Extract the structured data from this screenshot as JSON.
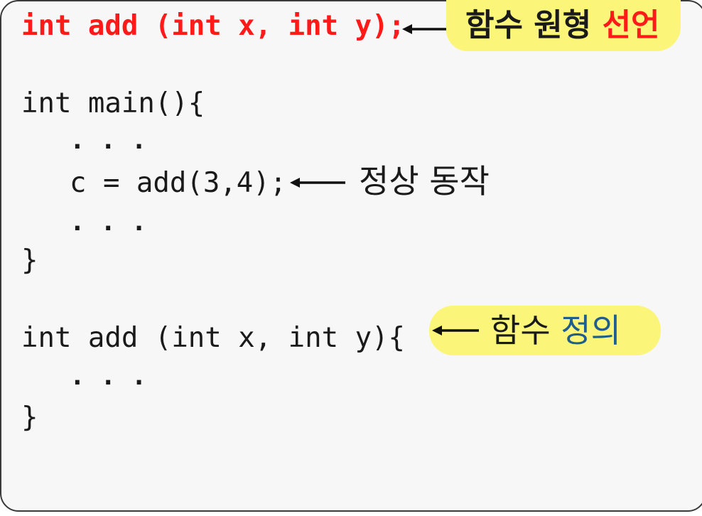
{
  "code": {
    "prototype_line": "int add (int x, int y);",
    "main_open": "int main(){",
    "ellipsis_1": ". . .",
    "call_line": "c = add(3,4);",
    "ellipsis_2": ". . .",
    "main_close": "}",
    "def_open": "int add (int x, int y){",
    "ellipsis_3": ". . .",
    "def_close": "}"
  },
  "annotations": {
    "prototype_label_main": "함수 원형",
    "prototype_label_accent": "선언",
    "call_label": "정상 동작",
    "definition_label_main": "함수",
    "definition_label_accent": "정의"
  },
  "colors": {
    "declaration": "#ff1a1a",
    "accent_red": "#ff1a1a",
    "accent_teal": "#1f5e8c",
    "highlight": "#fbf57a",
    "panel_background": "#f7f7f7"
  }
}
